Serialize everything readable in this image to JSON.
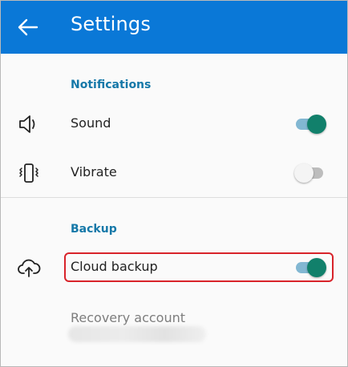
{
  "appbar": {
    "title": "Settings",
    "back_icon": "arrow-left-icon"
  },
  "notifications": {
    "header": "Notifications",
    "items": [
      {
        "label": "Sound",
        "icon": "speaker-icon",
        "enabled": true
      },
      {
        "label": "Vibrate",
        "icon": "phone-vibrate-icon",
        "enabled": false
      }
    ]
  },
  "backup": {
    "header": "Backup",
    "cloud": {
      "label": "Cloud backup",
      "icon": "cloud-upload-icon",
      "enabled": true
    },
    "recovery_label": "Recovery account"
  },
  "colors": {
    "appbar": "#0a78d7",
    "section_header": "#1578a8",
    "switch_on_thumb": "#11806b",
    "switch_on_track": "#82b7d2",
    "highlight": "#d8232a"
  }
}
